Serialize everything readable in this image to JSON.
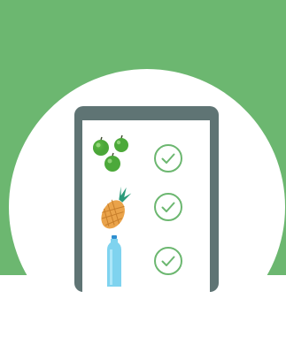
{
  "colors": {
    "background": "#6cb770",
    "circle": "#ffffff",
    "device_frame": "#5f7474",
    "screen": "#ffffff",
    "check": "#6cb770",
    "apple": "#4ca93a",
    "pineapple": "#eaa34a",
    "pineapple_leaves": "#2a9a79",
    "bottle": "#7fd3ef"
  },
  "checklist": [
    {
      "icon": "apples-icon",
      "checked": true
    },
    {
      "icon": "pineapple-icon",
      "checked": true
    },
    {
      "icon": "water-bottle-icon",
      "checked": true
    }
  ]
}
